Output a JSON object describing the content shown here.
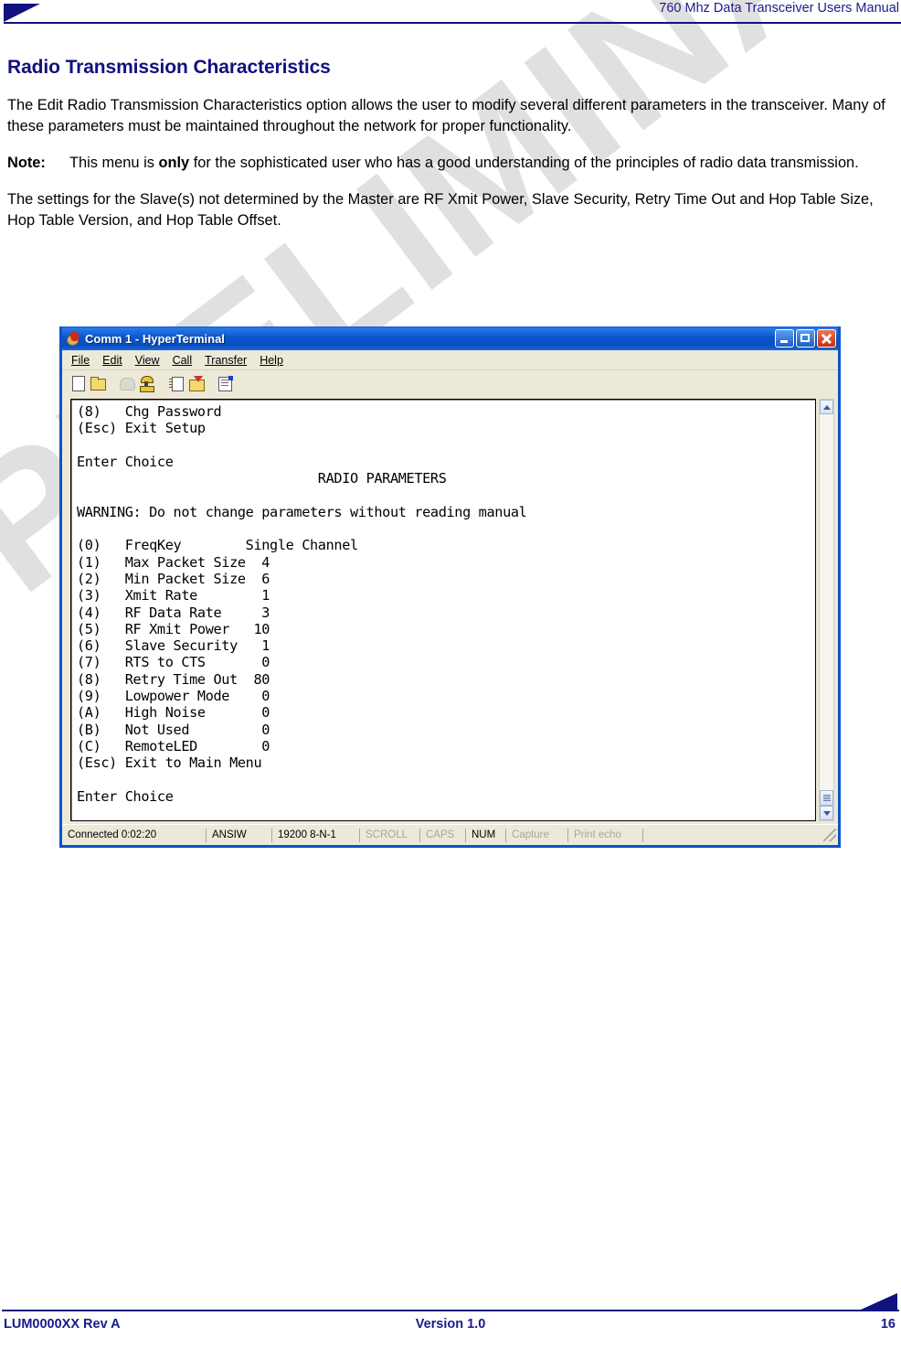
{
  "page": {
    "header_title": "760 Mhz Data Transceiver Users Manual",
    "watermark": "PRELIMINARY",
    "footer_left": "LUM0000XX Rev A",
    "footer_center": "Version 1.0",
    "footer_page": "16",
    "accent_color": "#11117f"
  },
  "content": {
    "section_title": "Radio Transmission Characteristics",
    "paragraph1": "The Edit Radio Transmission Characteristics option allows the user to modify several different parameters in the transceiver. Many of these parameters must be maintained throughout the network for proper functionality.",
    "note_label": "Note:",
    "note_text_part1": "This menu is ",
    "note_text_emphasis": "only",
    "note_text_part2": " for the sophisticated user who has a good understanding of the principles of radio data transmission.",
    "paragraph2": "The settings for the Slave(s) not determined by the Master are RF Xmit Power, Slave Security, Retry Time Out and Hop Table Size, Hop Table Version, and Hop Table Offset."
  },
  "terminal_window": {
    "title": "Comm 1 - HyperTerminal",
    "title_icon": "hyperterminal-icon",
    "window_buttons": {
      "minimize": "minimize-button",
      "maximize": "maximize-button",
      "close": "close-button"
    },
    "menu": [
      {
        "label": "File",
        "mnemonic": "F"
      },
      {
        "label": "Edit",
        "mnemonic": "E"
      },
      {
        "label": "View",
        "mnemonic": "V"
      },
      {
        "label": "Call",
        "mnemonic": "C"
      },
      {
        "label": "Transfer",
        "mnemonic": "T"
      },
      {
        "label": "Help",
        "mnemonic": "H"
      }
    ],
    "toolbar": [
      "new-connection-icon",
      "open-icon",
      "disconnect-icon",
      "call-icon",
      "send-file-icon",
      "receive-file-icon",
      "properties-icon"
    ],
    "screen_lines": [
      "(8)   Chg Password",
      "(Esc) Exit Setup",
      "",
      "Enter Choice",
      "                              RADIO PARAMETERS",
      "",
      "WARNING: Do not change parameters without reading manual",
      "",
      "(0)   FreqKey        Single Channel",
      "(1)   Max Packet Size  4",
      "(2)   Min Packet Size  6",
      "(3)   Xmit Rate        1",
      "(4)   RF Data Rate     3",
      "(5)   RF Xmit Power   10",
      "(6)   Slave Security   1",
      "(7)   RTS to CTS       0",
      "(8)   Retry Time Out  80",
      "(9)   Lowpower Mode    0",
      "(A)   High Noise       0",
      "(B)   Not Used         0",
      "(C)   RemoteLED        0",
      "(Esc) Exit to Main Menu",
      "",
      "Enter Choice"
    ],
    "radio_parameters": [
      {
        "key": "(0)",
        "name": "FreqKey",
        "value": "Single Channel"
      },
      {
        "key": "(1)",
        "name": "Max Packet Size",
        "value": "4"
      },
      {
        "key": "(2)",
        "name": "Min Packet Size",
        "value": "6"
      },
      {
        "key": "(3)",
        "name": "Xmit Rate",
        "value": "1"
      },
      {
        "key": "(4)",
        "name": "RF Data Rate",
        "value": "3"
      },
      {
        "key": "(5)",
        "name": "RF Xmit Power",
        "value": "10"
      },
      {
        "key": "(6)",
        "name": "Slave Security",
        "value": "1"
      },
      {
        "key": "(7)",
        "name": "RTS to CTS",
        "value": "0"
      },
      {
        "key": "(8)",
        "name": "Retry Time Out",
        "value": "80"
      },
      {
        "key": "(9)",
        "name": "Lowpower Mode",
        "value": "0"
      },
      {
        "key": "(A)",
        "name": "High Noise",
        "value": "0"
      },
      {
        "key": "(B)",
        "name": "Not Used",
        "value": "0"
      },
      {
        "key": "(C)",
        "name": "RemoteLED",
        "value": "0"
      }
    ],
    "status_bar": {
      "connected": "Connected 0:02:20",
      "emulation": "ANSIW",
      "settings": "19200 8-N-1",
      "scroll": "SCROLL",
      "caps": "CAPS",
      "num": "NUM",
      "capture": "Capture",
      "print_echo": "Print echo"
    },
    "scrollbar": {
      "up": "scroll-up-button",
      "down": "scroll-down-button",
      "thumb": "scrollbar-thumb"
    }
  }
}
